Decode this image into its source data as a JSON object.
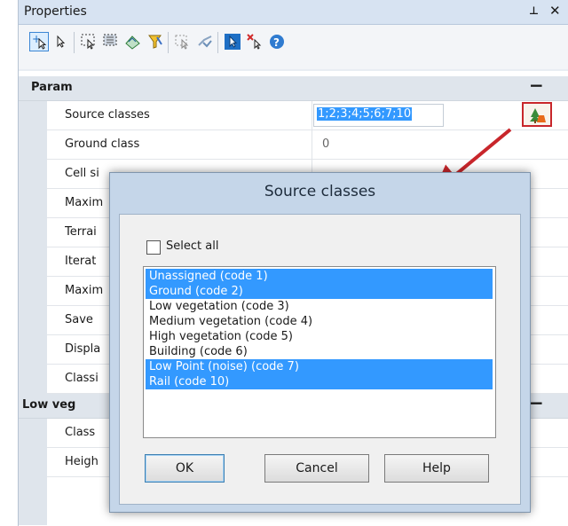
{
  "panel": {
    "title": "Properties",
    "pin_glyph": "⊥",
    "close_glyph": "✕"
  },
  "toolbar": {
    "icons": [
      "add-select-icon",
      "pointer-icon",
      "select-window-icon",
      "select-crossing-icon",
      "select-layers-icon",
      "filter-icon",
      "select-ptype-icon",
      "deselect-icon",
      "pointer-blue-icon",
      "clear-selection-icon",
      "help-icon"
    ]
  },
  "categories": [
    {
      "label": "Param",
      "toggle": "−"
    },
    {
      "label": "Low veg",
      "toggle": "−"
    }
  ],
  "param_rows": [
    {
      "name": "Source classes",
      "value": "1;2;3;4;5;6;7;10"
    },
    {
      "name": "Ground class",
      "value": "0"
    },
    {
      "name": "Cell si",
      "value": ""
    },
    {
      "name": "Maxim",
      "value": ""
    },
    {
      "name": "Terrai",
      "value": ""
    },
    {
      "name": "Iterat",
      "value": ""
    },
    {
      "name": "Maxim",
      "value": ""
    },
    {
      "name": "Save",
      "value": ""
    },
    {
      "name": "Displa",
      "value": ""
    },
    {
      "name": "Classi",
      "value": ""
    }
  ],
  "lowveg_rows": [
    {
      "name": "Class",
      "value": ""
    },
    {
      "name": "Heigh",
      "value": ""
    }
  ],
  "dialog": {
    "title": "Source classes",
    "select_all_label": "Select all",
    "items": [
      {
        "label": "Unassigned (code 1)",
        "selected": true
      },
      {
        "label": "Ground (code 2)",
        "selected": true
      },
      {
        "label": "Low vegetation (code 3)",
        "selected": false
      },
      {
        "label": "Medium vegetation (code 4)",
        "selected": false
      },
      {
        "label": "High vegetation (code 5)",
        "selected": false
      },
      {
        "label": "Building (code 6)",
        "selected": false
      },
      {
        "label": "Low Point (noise) (code 7)",
        "selected": true
      },
      {
        "label": "Rail (code 10)",
        "selected": true
      }
    ],
    "ok_label": "OK",
    "cancel_label": "Cancel",
    "help_label": "Help"
  },
  "colors": {
    "selection": "#3399ff",
    "highlight_box": "#c8262b",
    "arrow": "#c8262b"
  }
}
